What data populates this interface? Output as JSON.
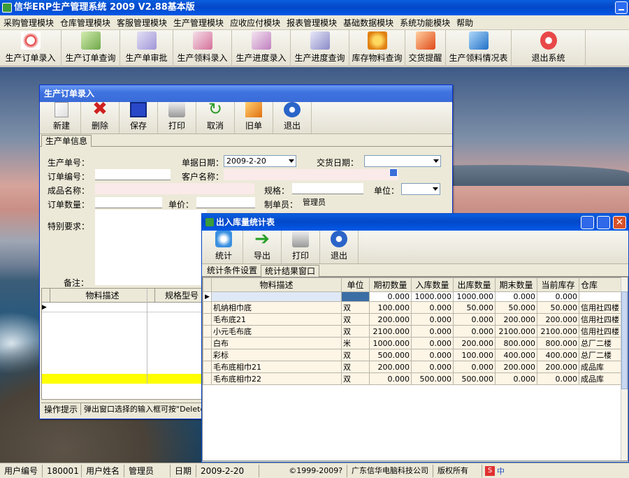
{
  "app": {
    "title": "信华ERP生产管理系统   2009   V2.88基本版"
  },
  "menu": [
    "采购管理模块",
    "仓库管理模块",
    "客服管理模块",
    "生产管理模块",
    "应收应付模块",
    "报表管理模块",
    "基础数据模块",
    "系统功能模块",
    "帮助"
  ],
  "main_toolbar": [
    "生产订单录入",
    "生产订单查询",
    "生产单审批",
    "生产领料录入",
    "生产进度录入",
    "生产进度查询",
    "库存物料查询",
    "交货提醒",
    "生产领料情况表",
    "退出系统"
  ],
  "order_window": {
    "title": "生产订单录入",
    "toolbar": [
      "新建",
      "删除",
      "保存",
      "打印",
      "取消",
      "旧单",
      "退出"
    ],
    "tab": "生产单信息",
    "labels": {
      "order_no": "生产单号：",
      "doc_date": "单据日期：",
      "delivery_date": "交货日期：",
      "order_code": "订单编号：",
      "customer": "客户名称：",
      "product": "成品名称：",
      "spec": "规格：",
      "unit": "单位：",
      "qty": "订单数量：",
      "price": "单价：",
      "maker": "制单员：",
      "special": "特别要求：",
      "remark": "备注："
    },
    "values": {
      "doc_date": "2009-2-20",
      "maker": "管理员"
    },
    "grid_headers": [
      "物料描述",
      "规格型号"
    ],
    "hint_label": "操作提示",
    "hint_text": "弹出窗口选择的输入框可按\"Delete"
  },
  "stats_window": {
    "title": "出入库量统计表",
    "toolbar": [
      "统计",
      "导出",
      "打印",
      "退出"
    ],
    "tabs": [
      "统计条件设置",
      "统计结果窗口"
    ],
    "headers": [
      "物料描述",
      "单位",
      "期初数量",
      "入库数量",
      "出库数量",
      "期末数量",
      "当前库存",
      "仓库"
    ],
    "rows": [
      [
        "",
        "",
        "0.000",
        "1000.000",
        "1000.000",
        "0.000",
        "0.000",
        ""
      ],
      [
        "机纳相巾底",
        "双",
        "100.000",
        "0.000",
        "50.000",
        "50.000",
        "50.000",
        "信用社四楼"
      ],
      [
        "毛布底21",
        "双",
        "200.000",
        "0.000",
        "0.000",
        "200.000",
        "200.000",
        "信用社四楼"
      ],
      [
        "小元毛布底",
        "双",
        "2100.000",
        "0.000",
        "0.000",
        "2100.000",
        "2100.000",
        "信用社四楼"
      ],
      [
        "白布",
        "米",
        "1000.000",
        "0.000",
        "200.000",
        "800.000",
        "800.000",
        "总厂二楼"
      ],
      [
        "彩标",
        "双",
        "500.000",
        "0.000",
        "100.000",
        "400.000",
        "400.000",
        "总厂二楼"
      ],
      [
        "毛布底相巾21",
        "双",
        "200.000",
        "0.000",
        "0.000",
        "200.000",
        "200.000",
        "成品库"
      ],
      [
        "毛布底相巾22",
        "双",
        "0.000",
        "500.000",
        "500.000",
        "0.000",
        "0.000",
        "成品库"
      ]
    ]
  },
  "status": {
    "user_no_label": "用户编号",
    "user_no": "180001",
    "user_name_label": "用户姓名",
    "user_name": "管理员",
    "date_label": "日期",
    "date": "2009-2-20",
    "copyright": "©1999-2009?",
    "company": "广东信华电脑科技公司",
    "rights": "版权所有"
  },
  "colors": {
    "title_blue": "#0348c8",
    "yellow_row": "#ffff00",
    "selected_cell": "#3a6ea5",
    "row_bg": "#fdf5e6"
  }
}
